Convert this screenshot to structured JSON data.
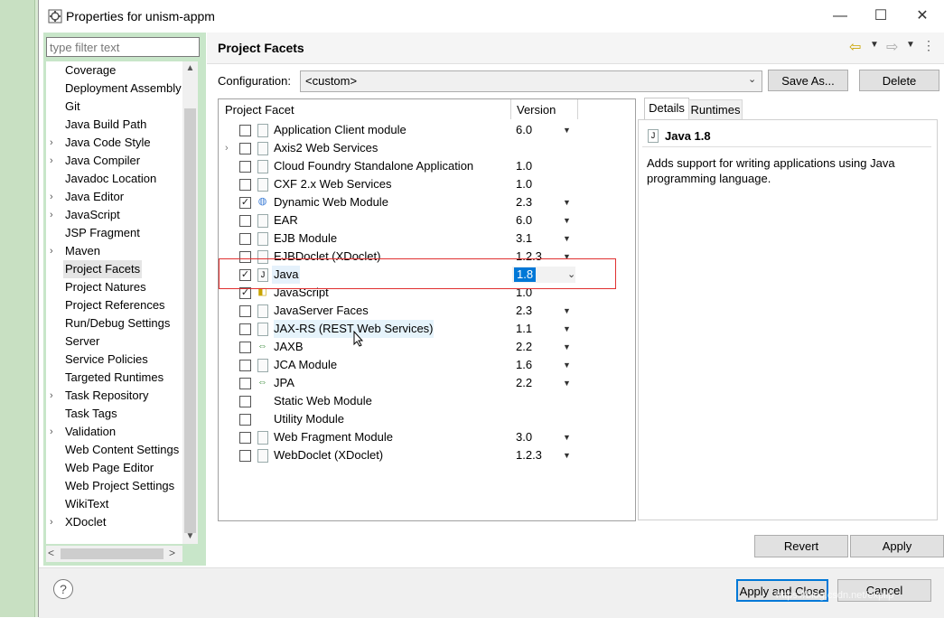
{
  "window": {
    "title": "Properties for unism-appm",
    "minimize": "—",
    "maximize": "☐",
    "close": "✕"
  },
  "sidebar": {
    "filter_placeholder": "type filter text",
    "items": [
      {
        "label": "Coverage",
        "expandable": false
      },
      {
        "label": "Deployment Assembly",
        "expandable": false
      },
      {
        "label": "Git",
        "expandable": false
      },
      {
        "label": "Java Build Path",
        "expandable": false
      },
      {
        "label": "Java Code Style",
        "expandable": true
      },
      {
        "label": "Java Compiler",
        "expandable": true
      },
      {
        "label": "Javadoc Location",
        "expandable": false
      },
      {
        "label": "Java Editor",
        "expandable": true
      },
      {
        "label": "JavaScript",
        "expandable": true
      },
      {
        "label": "JSP Fragment",
        "expandable": false
      },
      {
        "label": "Maven",
        "expandable": true
      },
      {
        "label": "Project Facets",
        "expandable": false,
        "selected": true
      },
      {
        "label": "Project Natures",
        "expandable": false
      },
      {
        "label": "Project References",
        "expandable": false
      },
      {
        "label": "Run/Debug Settings",
        "expandable": false
      },
      {
        "label": "Server",
        "expandable": false
      },
      {
        "label": "Service Policies",
        "expandable": false
      },
      {
        "label": "Targeted Runtimes",
        "expandable": false
      },
      {
        "label": "Task Repository",
        "expandable": true
      },
      {
        "label": "Task Tags",
        "expandable": false
      },
      {
        "label": "Validation",
        "expandable": true
      },
      {
        "label": "Web Content Settings",
        "expandable": false
      },
      {
        "label": "Web Page Editor",
        "expandable": false
      },
      {
        "label": "Web Project Settings",
        "expandable": false
      },
      {
        "label": "WikiText",
        "expandable": false
      },
      {
        "label": "XDoclet",
        "expandable": true
      }
    ]
  },
  "page": {
    "title": "Project Facets",
    "configuration_label": "Configuration:",
    "configuration_value": "<custom>",
    "save_as": "Save As...",
    "delete": "Delete"
  },
  "facets": {
    "header_facet": "Project Facet",
    "header_version": "Version",
    "rows": [
      {
        "name": "Application Client module",
        "version": "6.0",
        "checked": false,
        "dropdown": true,
        "icon": "doc",
        "expander": false
      },
      {
        "name": "Axis2 Web Services",
        "version": "",
        "checked": false,
        "dropdown": false,
        "icon": "doc",
        "expander": true
      },
      {
        "name": "Cloud Foundry Standalone Application",
        "version": "1.0",
        "checked": false,
        "dropdown": false,
        "icon": "doc",
        "expander": false
      },
      {
        "name": "CXF 2.x Web Services",
        "version": "1.0",
        "checked": false,
        "dropdown": false,
        "icon": "doc",
        "expander": false
      },
      {
        "name": "Dynamic Web Module",
        "version": "2.3",
        "checked": true,
        "dropdown": true,
        "icon": "web",
        "expander": false
      },
      {
        "name": "EAR",
        "version": "6.0",
        "checked": false,
        "dropdown": true,
        "icon": "doc",
        "expander": false
      },
      {
        "name": "EJB Module",
        "version": "3.1",
        "checked": false,
        "dropdown": true,
        "icon": "doc",
        "expander": false
      },
      {
        "name": "EJBDoclet (XDoclet)",
        "version": "1.2.3",
        "checked": false,
        "dropdown": true,
        "icon": "doc",
        "expander": false
      },
      {
        "name": "Java",
        "version": "1.8",
        "checked": true,
        "dropdown": true,
        "icon": "java",
        "expander": false,
        "selected": true
      },
      {
        "name": "JavaScript",
        "version": "1.0",
        "checked": true,
        "dropdown": false,
        "icon": "js",
        "expander": false
      },
      {
        "name": "JavaServer Faces",
        "version": "2.3",
        "checked": false,
        "dropdown": true,
        "icon": "doc",
        "expander": false
      },
      {
        "name": "JAX-RS (REST Web Services)",
        "version": "1.1",
        "checked": false,
        "dropdown": true,
        "icon": "doc",
        "expander": false,
        "hover": true
      },
      {
        "name": "JAXB",
        "version": "2.2",
        "checked": false,
        "dropdown": true,
        "icon": "arrows",
        "expander": false
      },
      {
        "name": "JCA Module",
        "version": "1.6",
        "checked": false,
        "dropdown": true,
        "icon": "doc",
        "expander": false
      },
      {
        "name": "JPA",
        "version": "2.2",
        "checked": false,
        "dropdown": true,
        "icon": "arrows",
        "expander": false
      },
      {
        "name": "Static Web Module",
        "version": "",
        "checked": false,
        "dropdown": false,
        "icon": "none",
        "expander": false
      },
      {
        "name": "Utility Module",
        "version": "",
        "checked": false,
        "dropdown": false,
        "icon": "none",
        "expander": false
      },
      {
        "name": "Web Fragment Module",
        "version": "3.0",
        "checked": false,
        "dropdown": true,
        "icon": "doc",
        "expander": false
      },
      {
        "name": "WebDoclet (XDoclet)",
        "version": "1.2.3",
        "checked": false,
        "dropdown": true,
        "icon": "doc",
        "expander": false
      }
    ]
  },
  "details": {
    "tab_details": "Details",
    "tab_runtimes": "Runtimes",
    "title": "Java 1.8",
    "description": "Adds support for writing applications using Java programming language."
  },
  "buttons": {
    "revert": "Revert",
    "apply": "Apply",
    "apply_and_close": "Apply and Close",
    "cancel": "Cancel",
    "help": "?"
  },
  "watermark": "https://blog.csdn.net/expllp",
  "colors": {
    "selection": "#0078d7",
    "highlight_box": "#e03030",
    "sidebar_bg": "#c8e6c9"
  }
}
